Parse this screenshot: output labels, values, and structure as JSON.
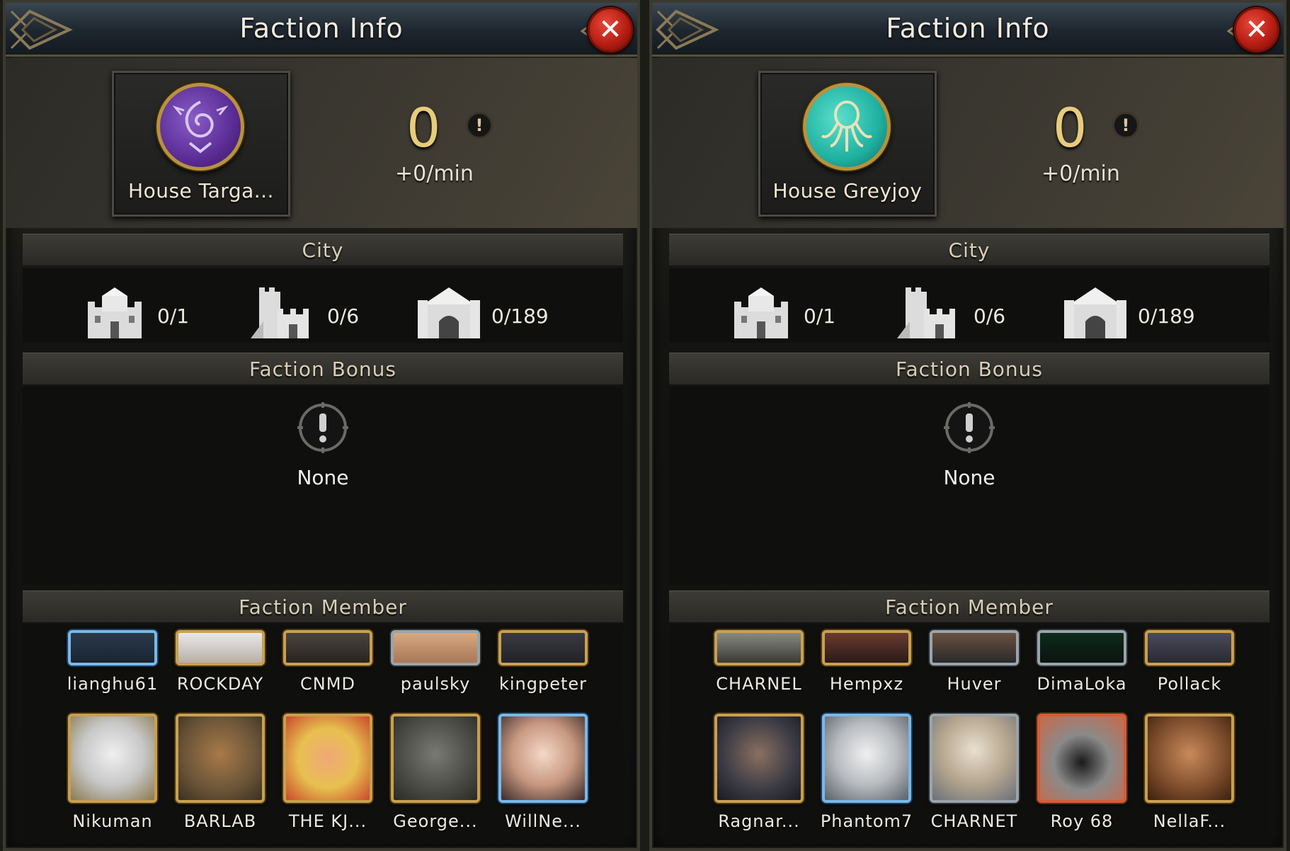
{
  "panels": [
    {
      "title": "Faction Info",
      "house_name": "House Targa...",
      "score": "0",
      "rate": "+0/min",
      "city_header": "City",
      "cities": [
        "0/1",
        "0/6",
        "0/189"
      ],
      "bonus_header": "Faction Bonus",
      "bonus_value": "None",
      "member_header": "Faction Member",
      "members_row1": [
        "lianghu61",
        "ROCKDAY",
        "CNMD",
        "paulsky",
        "kingpeter"
      ],
      "members_row2": [
        "Nikuman",
        "BARLAB",
        "THE KJ...",
        "George...",
        "WillNe..."
      ]
    },
    {
      "title": "Faction Info",
      "house_name": "House Greyjoy",
      "score": "0",
      "rate": "+0/min",
      "city_header": "City",
      "cities": [
        "0/1",
        "0/6",
        "0/189"
      ],
      "bonus_header": "Faction Bonus",
      "bonus_value": "None",
      "member_header": "Faction Member",
      "members_row1": [
        "CHARNEL",
        "Hempxz",
        "Huver",
        "DimaLoka",
        "Pollack"
      ],
      "members_row2": [
        "Ragnar...",
        "Phantom7",
        "CHARNET",
        "Roy 68",
        "NellaF..."
      ]
    }
  ],
  "colors": {
    "accent_gold": "#e8cc7c",
    "close_red": "#c8281a",
    "targaryen_purple": "#6a3aa8",
    "greyjoy_teal": "#28b8a8"
  },
  "icons": {
    "close": "close-icon",
    "info": "info-icon",
    "castle": "castle-icon",
    "fort": "fort-icon",
    "gate": "gate-icon",
    "bonus": "alert-icon"
  }
}
